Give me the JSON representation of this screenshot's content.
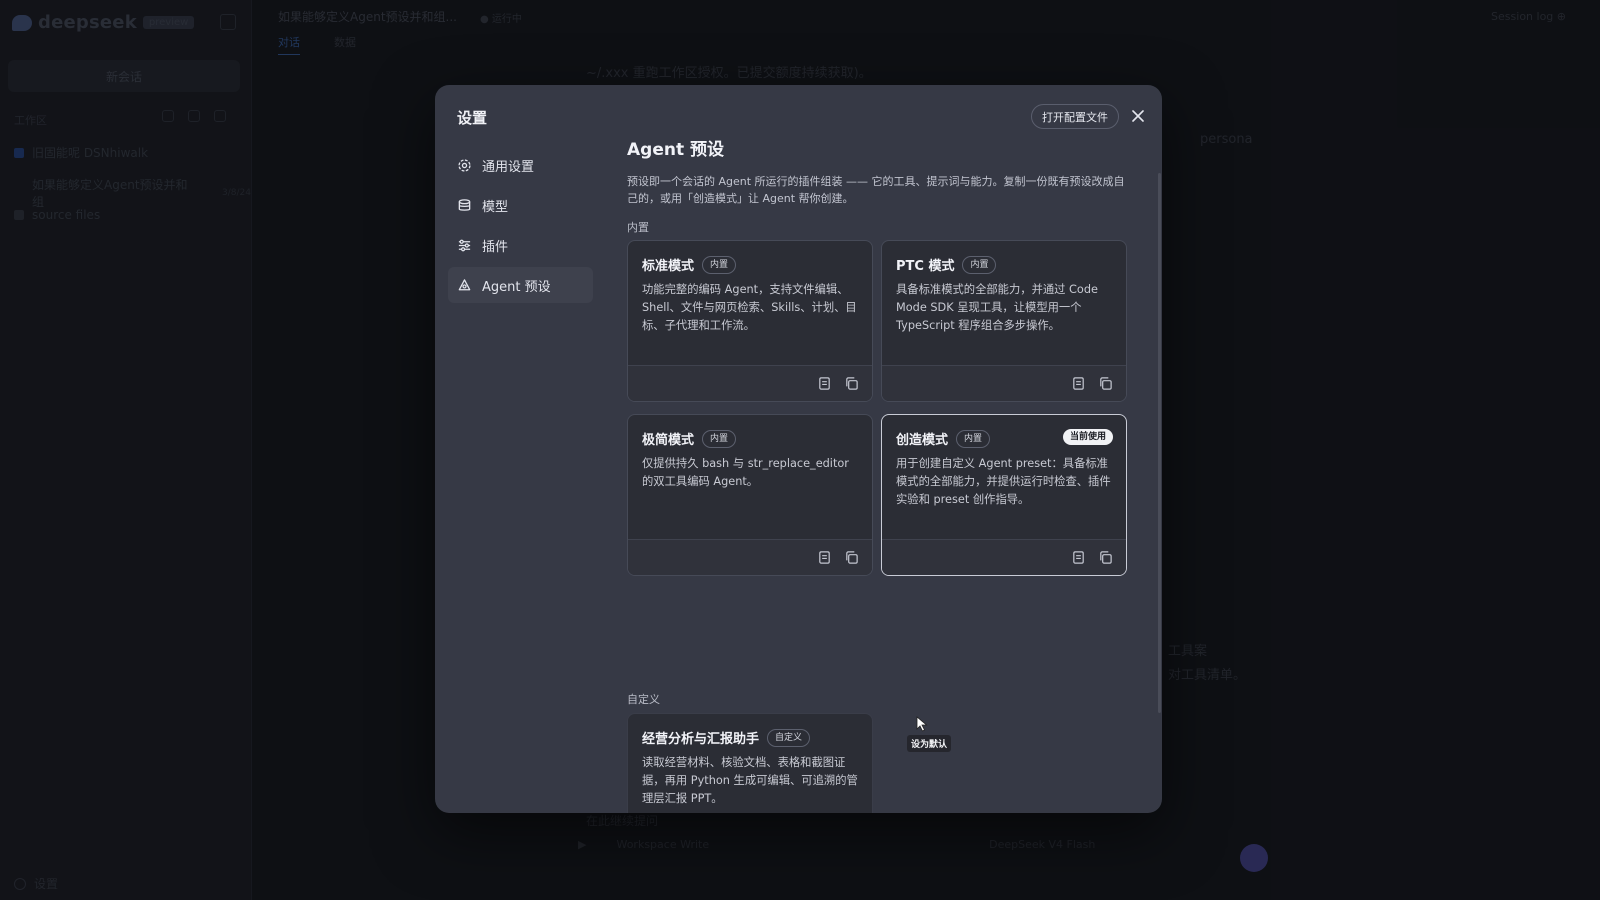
{
  "background": {
    "brand": "deepseek",
    "brand_badge": "preview",
    "new_chat": "新会话",
    "workspace_label": "工作区",
    "ws_items": [
      "旧固能呢 DSNhiwalk",
      "如果能够定义Agent预设并和组",
      "source files"
    ],
    "ws_item_tag": "3/8/24",
    "settings_label": "设置",
    "top_title": "如果能够定义Agent预设并和组...",
    "top_status": "● 运行中",
    "top_right": "Session log ⊕",
    "tabs": [
      "对话",
      "数据"
    ],
    "chat_lines": [
      "~/.xxx 重跑工作区授权。已提交额度持续获取)。",
      "persona",
      "工具案",
      "对工具清单。"
    ],
    "composer_items": [
      "Workspace Write",
      "DeepSeek V4 Flash"
    ],
    "composer_placeholder": "在此继续提问"
  },
  "modal": {
    "title": "设置",
    "open_config_label": "打开配置文件",
    "nav": [
      {
        "label": "通用设置",
        "icon": "gear-icon"
      },
      {
        "label": "模型",
        "icon": "database-icon"
      },
      {
        "label": "插件",
        "icon": "sliders-icon"
      },
      {
        "label": "Agent 预设",
        "icon": "agent-icon"
      }
    ],
    "content": {
      "title": "Agent 预设",
      "description": "预设即一个会话的 Agent 所运行的插件组装 —— 它的工具、提示词与能力。复制一份既有预设改成自己的，或用「创造模式」让 Agent 帮你创建。",
      "builtin_label": "内置",
      "custom_label": "自定义",
      "builtin_cards": [
        {
          "name": "标准模式",
          "badge": "内置",
          "desc": "功能完整的编码 Agent，支持文件编辑、Shell、文件与网页检索、Skills、计划、目标、子代理和工作流。",
          "current": false
        },
        {
          "name": "PTC 模式",
          "badge": "内置",
          "desc": "具备标准模式的全部能力，并通过 Code Mode SDK 呈现工具，让模型用一个 TypeScript 程序组合多步操作。",
          "current": false
        },
        {
          "name": "极简模式",
          "badge": "内置",
          "desc": "仅提供持久 bash 与 str_replace_editor 的双工具编码 Agent。",
          "current": false
        },
        {
          "name": "创造模式",
          "badge": "内置",
          "desc": "用于创建自定义 Agent preset：具备标准模式的全部能力，并提供运行时检查、插件实验和 preset 创作指导。",
          "current": true,
          "current_label": "当前使用"
        }
      ],
      "custom_cards": [
        {
          "name": "经营分析与汇报助手",
          "badge": "自定义",
          "desc": "读取经营材料、核验文档、表格和截图证据，再用 Python 生成可编辑、可追溯的管理层汇报 PPT。"
        }
      ],
      "tooltip": "设为默认"
    }
  }
}
